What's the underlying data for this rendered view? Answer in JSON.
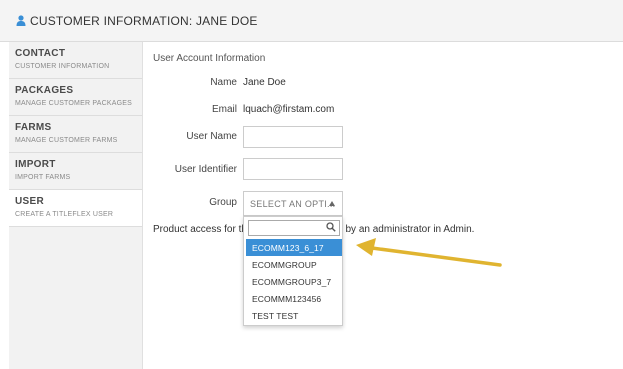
{
  "header": {
    "title": "CUSTOMER INFORMATION: JANE DOE",
    "icon": "user-icon",
    "accent_color": "#3a8fd6"
  },
  "sidebar": {
    "items": [
      {
        "title": "CONTACT",
        "subtitle": "CUSTOMER INFORMATION",
        "active": false
      },
      {
        "title": "PACKAGES",
        "subtitle": "MANAGE CUSTOMER PACKAGES",
        "active": false
      },
      {
        "title": "FARMS",
        "subtitle": "MANAGE CUSTOMER FARMS",
        "active": false
      },
      {
        "title": "IMPORT",
        "subtitle": "IMPORT FARMS",
        "active": false
      },
      {
        "title": "USER",
        "subtitle": "CREATE A TITLEFLEX USER",
        "active": true
      }
    ]
  },
  "main": {
    "section_title": "User Account Information",
    "name_label": "Name",
    "name_value": "Jane Doe",
    "email_label": "Email",
    "email_value": "lquach@firstam.com",
    "username_label": "User Name",
    "username_value": "",
    "identifier_label": "User Identifier",
    "identifier_value": "",
    "group_label": "Group",
    "group_placeholder": "SELECT AN OPTI...",
    "product_text_start": "Product access for thi",
    "product_text_end": "d by an administrator in Admin."
  },
  "dropdown": {
    "search_value": "",
    "options": [
      {
        "label": "ECOMM123_6_17",
        "selected": true
      },
      {
        "label": "ECOMMGROUP",
        "selected": false
      },
      {
        "label": "ECOMMGROUP3_7",
        "selected": false
      },
      {
        "label": "ECOMMM123456",
        "selected": false
      },
      {
        "label": "TEST TEST",
        "selected": false
      }
    ],
    "highlight_color": "#3a8fd6"
  },
  "annotation": {
    "arrow_color": "#e0b430"
  }
}
